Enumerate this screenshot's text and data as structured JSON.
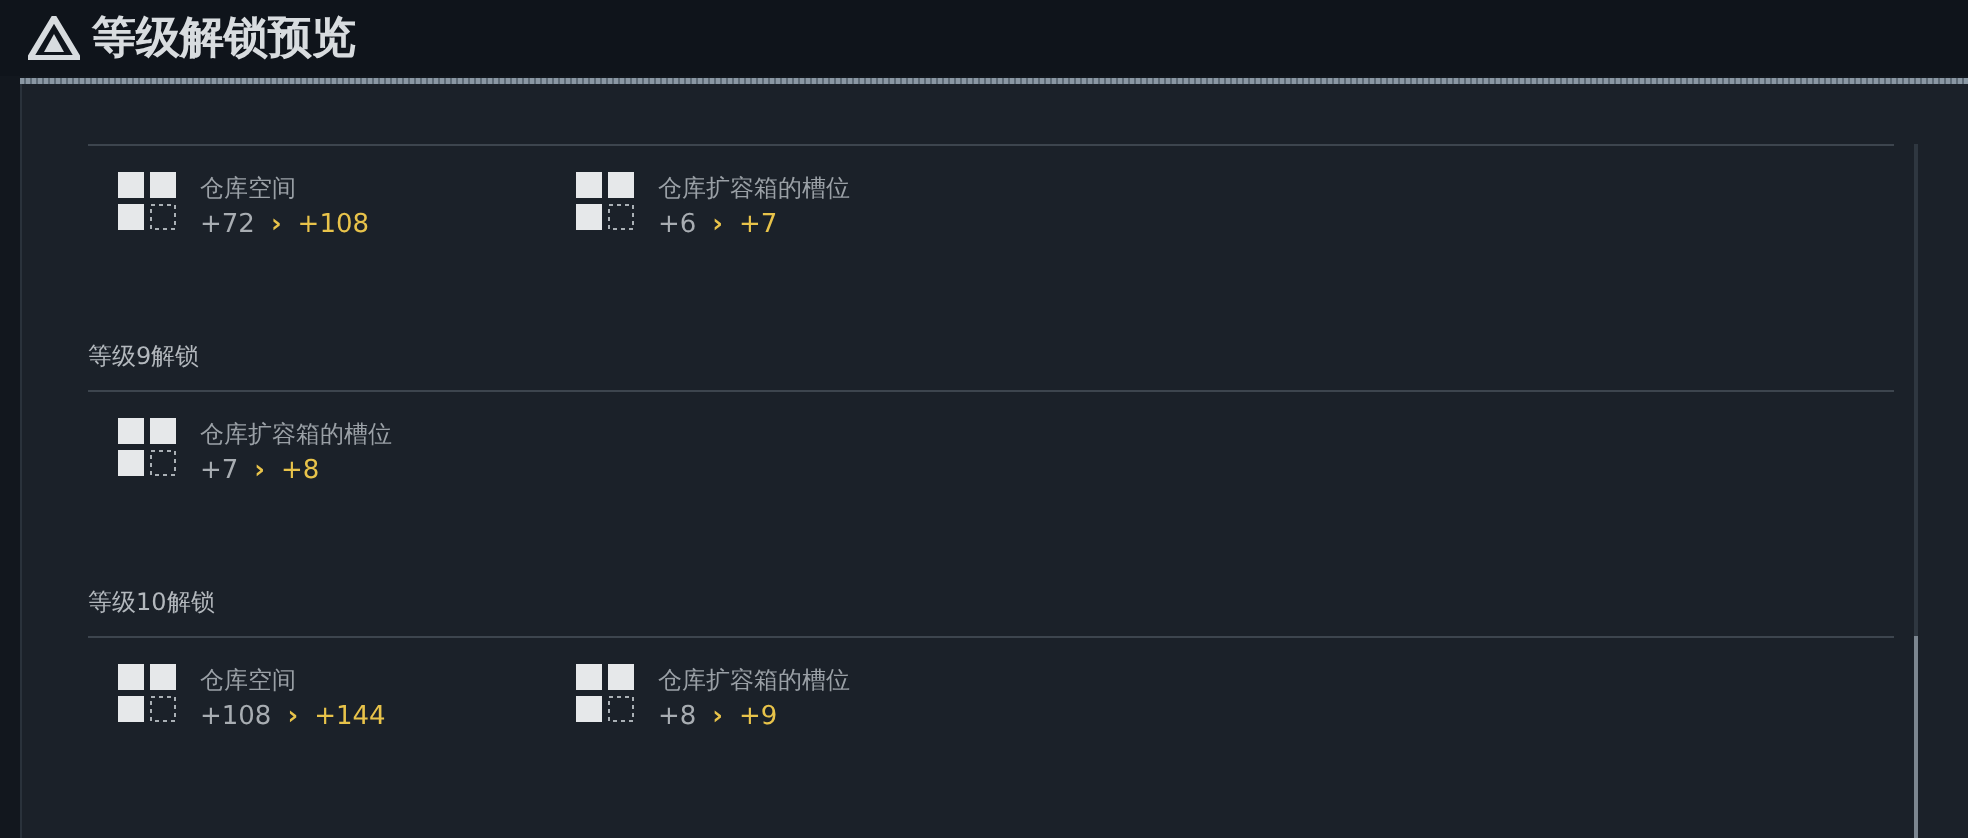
{
  "title": "等级解锁预览",
  "sections": [
    {
      "items": [
        {
          "name": "仓库空间",
          "from": "+72",
          "arrow": "›",
          "to": "+108"
        },
        {
          "name": "仓库扩容箱的槽位",
          "from": "+6",
          "arrow": "›",
          "to": "+7"
        }
      ]
    },
    {
      "title": "等级9解锁",
      "items": [
        {
          "name": "仓库扩容箱的槽位",
          "from": "+7",
          "arrow": "›",
          "to": "+8"
        }
      ]
    },
    {
      "title": "等级10解锁",
      "items": [
        {
          "name": "仓库空间",
          "from": "+108",
          "arrow": "›",
          "to": "+144"
        },
        {
          "name": "仓库扩容箱的槽位",
          "from": "+8",
          "arrow": "›",
          "to": "+9"
        }
      ]
    }
  ]
}
